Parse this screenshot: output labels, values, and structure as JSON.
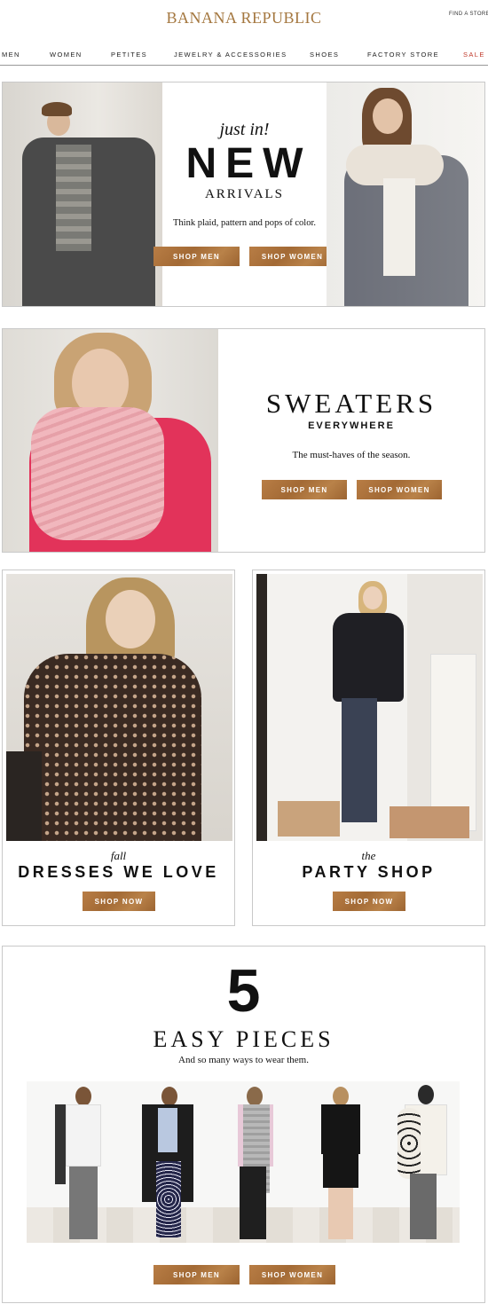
{
  "header": {
    "brand": "BANANA REPUBLIC",
    "find_store": "FIND A STORE GIFT"
  },
  "nav": [
    "MEN",
    "WOMEN",
    "PETITES",
    "JEWELRY & ACCESSORIES",
    "SHOES",
    "FACTORY STORE",
    "SALE"
  ],
  "hero": {
    "kicker": "just in!",
    "title": "NEW",
    "subtitle": "ARRIVALS",
    "tagline": "Think plaid, pattern and pops of color.",
    "btn_men": "SHOP MEN",
    "btn_women": "SHOP WOMEN"
  },
  "sweaters": {
    "title": "SWEATERS",
    "subtitle": "EVERYWHERE",
    "tagline": "The must-haves of the season.",
    "btn_men": "SHOP MEN",
    "btn_women": "SHOP WOMEN"
  },
  "dresses": {
    "kicker": "fall",
    "title": "DRESSES WE LOVE",
    "btn": "SHOP NOW"
  },
  "party": {
    "kicker": "the",
    "title": "PARTY SHOP",
    "btn": "SHOP NOW"
  },
  "easy": {
    "number": "5",
    "title": "EASY PIECES",
    "tagline": "And so many ways to wear them.",
    "btn_men": "SHOP MEN",
    "btn_women": "SHOP WOMEN"
  },
  "colors": {
    "brand": "#a4773f",
    "button": "#a96f3a",
    "sale": "#c0392b"
  }
}
